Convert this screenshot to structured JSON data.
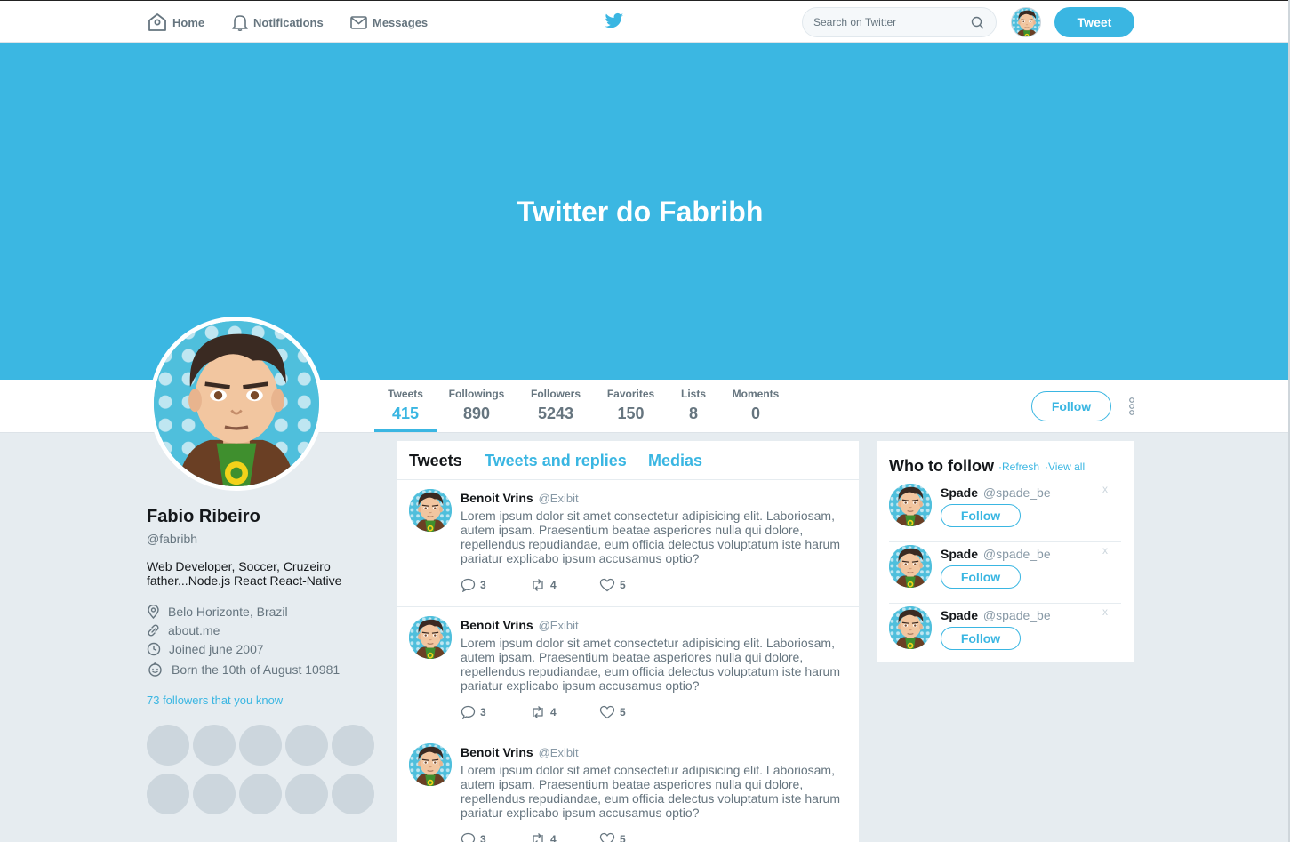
{
  "nav": {
    "home": "Home",
    "notifications": "Notifications",
    "messages": "Messages",
    "search_placeholder": "Search on Twitter",
    "tweet_button": "Tweet"
  },
  "banner": {
    "title": "Twitter do Fabribh"
  },
  "stats": [
    {
      "label": "Tweets",
      "value": "415"
    },
    {
      "label": "Followings",
      "value": "890"
    },
    {
      "label": "Followers",
      "value": "5243"
    },
    {
      "label": "Favorites",
      "value": "150"
    },
    {
      "label": "Lists",
      "value": "8"
    },
    {
      "label": "Moments",
      "value": "0"
    }
  ],
  "follow_button": "Follow",
  "profile": {
    "name": "Fabio Ribeiro",
    "handle": "@fabribh",
    "bio": "Web Developer, Soccer, Cruzeiro father...Node.js React React-Native",
    "location": "Belo Horizonte, Brazil",
    "website": "about.me",
    "joined": "Joined june 2007",
    "birthday": "Born the 10th of August 10981",
    "followers_you_know": "73 followers that you know"
  },
  "tabs": [
    "Tweets",
    "Tweets and replies",
    "Medias"
  ],
  "tweets": [
    {
      "name": "Benoit Vrins",
      "handle": "@Exibit",
      "text": "Lorem ipsum dolor sit amet consectetur adipisicing elit. Laboriosam, autem ipsam. Praesentium beatae asperiores nulla qui dolore, repellendus repudiandae, eum officia delectus voluptatum iste harum pariatur explicabo ipsum accusamus optio?",
      "replies": "3",
      "retweets": "4",
      "likes": "5"
    },
    {
      "name": "Benoit Vrins",
      "handle": "@Exibit",
      "text": "Lorem ipsum dolor sit amet consectetur adipisicing elit. Laboriosam, autem ipsam. Praesentium beatae asperiores nulla qui dolore, repellendus repudiandae, eum officia delectus voluptatum iste harum pariatur explicabo ipsum accusamus optio?",
      "replies": "3",
      "retweets": "4",
      "likes": "5"
    },
    {
      "name": "Benoit Vrins",
      "handle": "@Exibit",
      "text": "Lorem ipsum dolor sit amet consectetur adipisicing elit. Laboriosam, autem ipsam. Praesentium beatae asperiores nulla qui dolore, repellendus repudiandae, eum officia delectus voluptatum iste harum pariatur explicabo ipsum accusamus optio?",
      "replies": "3",
      "retweets": "4",
      "likes": "5"
    }
  ],
  "who_to_follow": {
    "title": "Who to follow",
    "refresh": "·Refresh",
    "view_all": "·View all",
    "close": "x",
    "items": [
      {
        "name": "Spade",
        "handle": "@spade_be",
        "button": "Follow"
      },
      {
        "name": "Spade",
        "handle": "@spade_be",
        "button": "Follow"
      },
      {
        "name": "Spade",
        "handle": "@spade_be",
        "button": "Follow"
      }
    ]
  },
  "colors": {
    "accent": "#3ab6e2",
    "banner": "#3bb7e2",
    "background": "#e6ecf0"
  }
}
